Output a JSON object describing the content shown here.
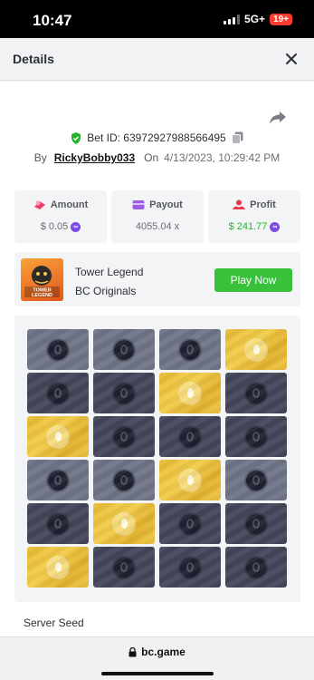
{
  "status_bar": {
    "time": "10:47",
    "network": "5G+",
    "battery": "19+"
  },
  "header": {
    "title": "Details",
    "close_icon": "close-icon"
  },
  "bet": {
    "id_label": "Bet ID: 63972927988566495",
    "by_label": "By",
    "user": "RickyBobby033",
    "on_label": "On",
    "date": "4/13/2023, 10:29:42 PM"
  },
  "stats": {
    "amount": {
      "label": "Amount",
      "value": "$ 0.05",
      "icon": "amount-icon"
    },
    "payout": {
      "label": "Payout",
      "value": "4055.04 x",
      "icon": "payout-icon"
    },
    "profit": {
      "label": "Profit",
      "value": "$ 241.77",
      "icon": "profit-icon"
    }
  },
  "game": {
    "name": "Tower Legend",
    "provider": "BC Originals",
    "play_label": "Play Now",
    "thumb_text": "TOWER LEGEND"
  },
  "board": {
    "rows": [
      [
        "light",
        "light",
        "light",
        "gold"
      ],
      [
        "dark",
        "dark",
        "gold",
        "dark"
      ],
      [
        "gold",
        "dark",
        "dark",
        "dark"
      ],
      [
        "light",
        "light",
        "gold",
        "light"
      ],
      [
        "dark",
        "gold",
        "dark",
        "dark"
      ],
      [
        "gold",
        "dark",
        "dark",
        "dark"
      ]
    ]
  },
  "server_seed_label": "Server Seed",
  "browser": {
    "url": "bc.game"
  },
  "colors": {
    "play_green": "#38c23b",
    "profit_green": "#24b52c",
    "gold": "#e8bb32",
    "tile_dark": "#43475a",
    "tile_light": "#6f7488"
  }
}
